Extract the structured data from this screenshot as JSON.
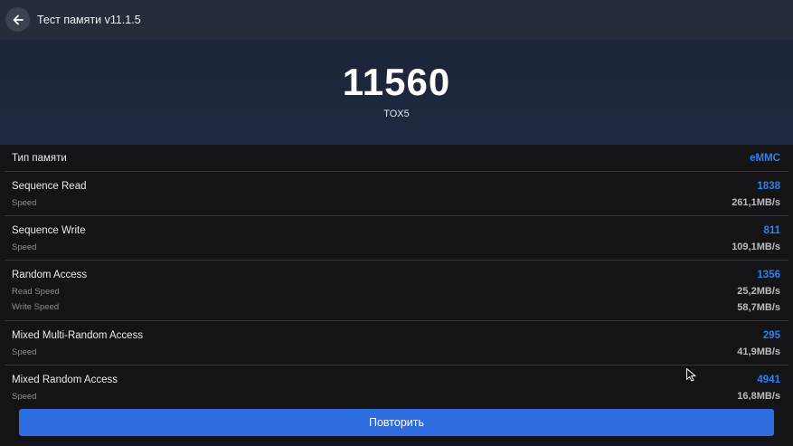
{
  "header": {
    "title": "Тест памяти v11.1.5",
    "back_icon": "arrow-left-icon"
  },
  "result": {
    "score": "11560",
    "device": "TOX5"
  },
  "rows": [
    {
      "label": "Тип памяти",
      "value": "eMMC",
      "subs": []
    },
    {
      "label": "Sequence Read",
      "value": "1838",
      "subs": [
        {
          "label": "Speed",
          "value": "261,1MB/s"
        }
      ]
    },
    {
      "label": "Sequence Write",
      "value": "811",
      "subs": [
        {
          "label": "Speed",
          "value": "109,1MB/s"
        }
      ]
    },
    {
      "label": "Random Access",
      "value": "1356",
      "subs": [
        {
          "label": "Read Speed",
          "value": "25,2MB/s"
        },
        {
          "label": "Write Speed",
          "value": "58,7MB/s"
        }
      ]
    },
    {
      "label": "Mixed Multi-Random Access",
      "value": "295",
      "subs": [
        {
          "label": "Speed",
          "value": "41,9MB/s"
        }
      ]
    },
    {
      "label": "Mixed Random Access",
      "value": "4941",
      "subs": [
        {
          "label": "Speed",
          "value": "16,8MB/s"
        }
      ]
    }
  ],
  "footer": {
    "repeat_label": "Повторить"
  },
  "colors": {
    "accent": "#2f80ed",
    "button": "#2d6de0",
    "header_bg": "#262d3a",
    "hero_bg": "#1e2941",
    "list_bg": "#141416"
  }
}
